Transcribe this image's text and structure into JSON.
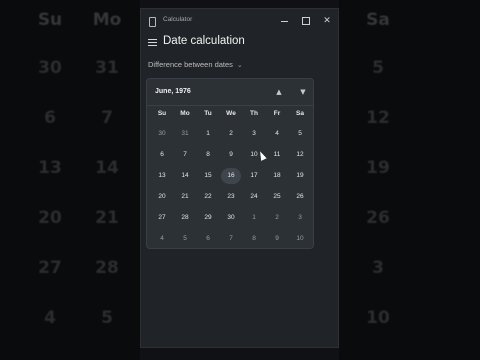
{
  "background_calendar": {
    "headers": [
      "Su",
      "Mo",
      "Sa"
    ],
    "col_left": [
      "30",
      "6",
      "13",
      "20",
      "27",
      "4"
    ],
    "col_mid": [
      "31",
      "7",
      "14",
      "21",
      "28",
      "5"
    ],
    "col_right": [
      "5",
      "12",
      "19",
      "26",
      "3",
      "10"
    ]
  },
  "window": {
    "title": "Calculator",
    "minimize_label": "",
    "maximize_label": "",
    "close_label": "✕"
  },
  "header": {
    "mode_title": "Date calculation"
  },
  "dropdown": {
    "selected": "Difference between dates",
    "chevron": "⌄"
  },
  "calendar": {
    "month_label": "June, 1976",
    "nav_up": "▲",
    "nav_down": "▼",
    "weekdays": [
      "Su",
      "Mo",
      "Tu",
      "We",
      "Th",
      "Fr",
      "Sa"
    ],
    "weeks": [
      [
        "30",
        "31",
        "1",
        "2",
        "3",
        "4",
        "5"
      ],
      [
        "6",
        "7",
        "8",
        "9",
        "10",
        "11",
        "12"
      ],
      [
        "13",
        "14",
        "15",
        "16",
        "17",
        "18",
        "19"
      ],
      [
        "20",
        "21",
        "22",
        "23",
        "24",
        "25",
        "26"
      ],
      [
        "27",
        "28",
        "29",
        "30",
        "1",
        "2",
        "3"
      ],
      [
        "4",
        "5",
        "6",
        "7",
        "8",
        "9",
        "10"
      ]
    ],
    "highlighted_day": "16"
  },
  "colors": {
    "window_bg": "#202428",
    "flyout_bg": "#2c3136",
    "highlight_bg": "#3f454c",
    "text": "#e6e6e6"
  }
}
